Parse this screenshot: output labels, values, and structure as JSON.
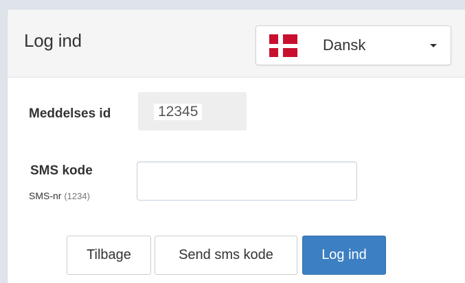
{
  "header": {
    "title": "Log ind"
  },
  "language": {
    "selected": "Dansk",
    "flag_icon": "denmark-flag-icon",
    "flag_colors": {
      "red": "#c8102e",
      "white": "#ffffff"
    }
  },
  "form": {
    "message_id_label": "Meddelses id",
    "message_id_value": "12345",
    "sms_code_label": "SMS kode",
    "sms_number_label": "SMS-nr",
    "sms_number_value": "(1234)",
    "sms_code_value": ""
  },
  "actions": {
    "back_label": "Tilbage",
    "send_sms_label": "Send sms kode",
    "login_label": "Log ind"
  },
  "colors": {
    "primary": "#3c7fc2",
    "background": "#dfe3ea"
  }
}
